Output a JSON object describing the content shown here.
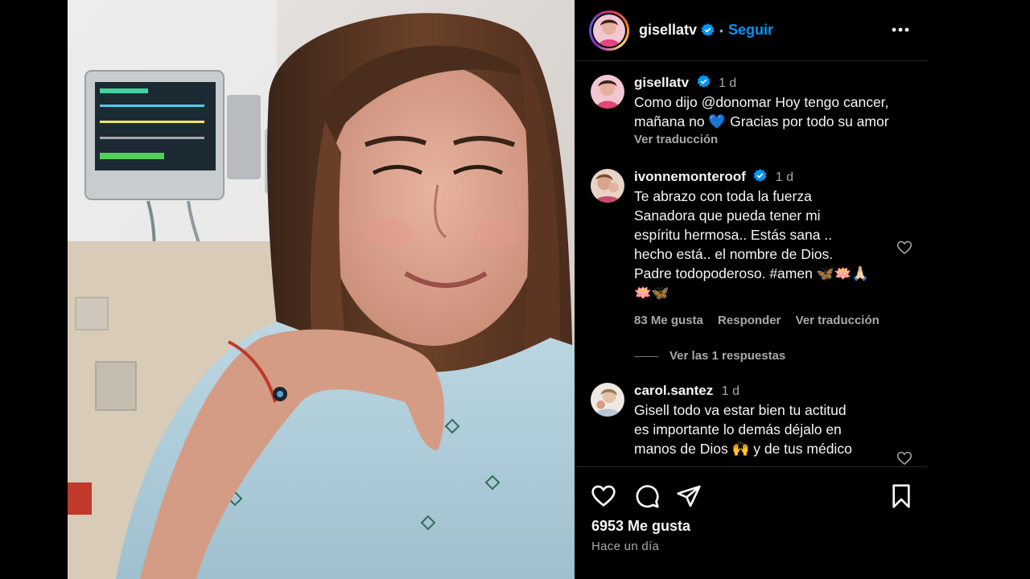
{
  "header": {
    "username": "gisellatv",
    "separator": "•",
    "follow_label": "Seguir",
    "more_icon": "more-horizontal-icon"
  },
  "caption": {
    "username": "gisellatv",
    "time": "1 d",
    "text_line1": "Como dijo @donomar Hoy tengo cancer,",
    "text_line2": "mañana no 💙 Gracias por todo su amor",
    "translate_label": "Ver traducción"
  },
  "comments": [
    {
      "username": "ivonnemonteroof",
      "time": "1 d",
      "lines": [
        "Te abrazo con toda la fuerza",
        "Sanadora que pueda tener mi",
        "espíritu hermosa.. Estás sana ..",
        "hecho está.. el nombre de Dios.",
        "Padre todopoderoso. #amen 🦋🪷🙏🏻",
        "🪷🦋"
      ],
      "likes": "83 Me gusta",
      "reply_label": "Responder",
      "translate_label": "Ver traducción",
      "replies_label": "Ver las 1 respuestas"
    },
    {
      "username": "carol.santez",
      "time": "1 d",
      "lines": [
        "Gisell todo va estar bien tu actitud",
        "es importante lo demás déjalo en",
        "manos de Dios 🙌 y de tus médico"
      ]
    }
  ],
  "footer": {
    "likes": "6953 Me gusta",
    "posted": "Hace un día"
  },
  "colors": {
    "link": "#0095f6",
    "verified": "#0095f6",
    "muted": "#a8a8a8"
  }
}
